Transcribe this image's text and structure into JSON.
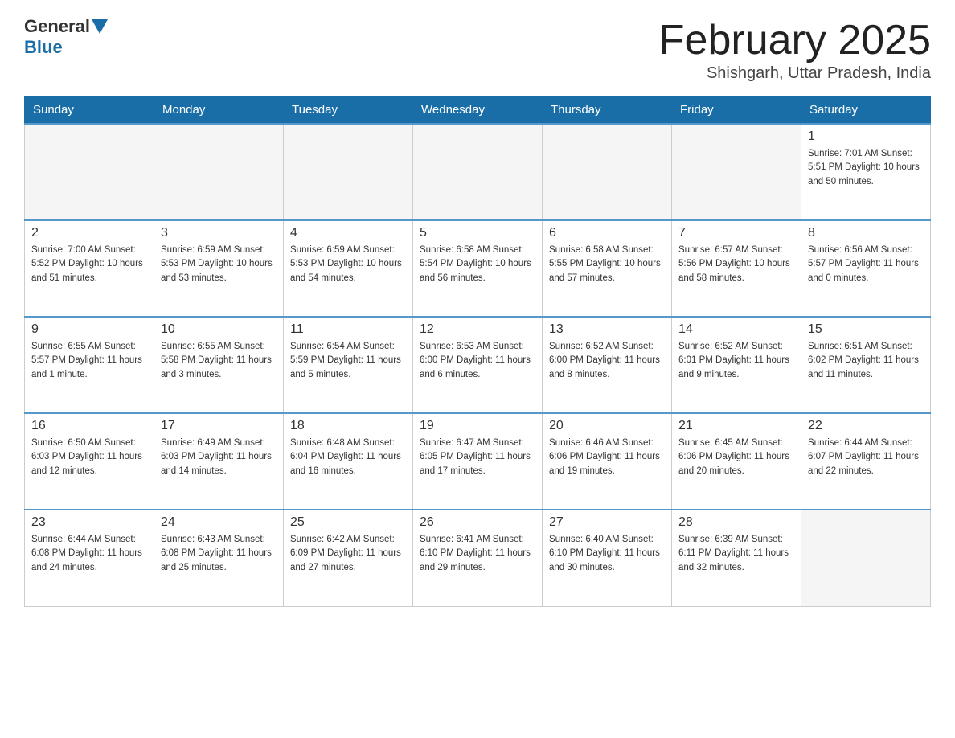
{
  "header": {
    "logo_general": "General",
    "logo_blue": "Blue",
    "month_title": "February 2025",
    "location": "Shishgarh, Uttar Pradesh, India"
  },
  "days_of_week": [
    "Sunday",
    "Monday",
    "Tuesday",
    "Wednesday",
    "Thursday",
    "Friday",
    "Saturday"
  ],
  "weeks": [
    [
      {
        "day": "",
        "info": ""
      },
      {
        "day": "",
        "info": ""
      },
      {
        "day": "",
        "info": ""
      },
      {
        "day": "",
        "info": ""
      },
      {
        "day": "",
        "info": ""
      },
      {
        "day": "",
        "info": ""
      },
      {
        "day": "1",
        "info": "Sunrise: 7:01 AM\nSunset: 5:51 PM\nDaylight: 10 hours and 50 minutes."
      }
    ],
    [
      {
        "day": "2",
        "info": "Sunrise: 7:00 AM\nSunset: 5:52 PM\nDaylight: 10 hours and 51 minutes."
      },
      {
        "day": "3",
        "info": "Sunrise: 6:59 AM\nSunset: 5:53 PM\nDaylight: 10 hours and 53 minutes."
      },
      {
        "day": "4",
        "info": "Sunrise: 6:59 AM\nSunset: 5:53 PM\nDaylight: 10 hours and 54 minutes."
      },
      {
        "day": "5",
        "info": "Sunrise: 6:58 AM\nSunset: 5:54 PM\nDaylight: 10 hours and 56 minutes."
      },
      {
        "day": "6",
        "info": "Sunrise: 6:58 AM\nSunset: 5:55 PM\nDaylight: 10 hours and 57 minutes."
      },
      {
        "day": "7",
        "info": "Sunrise: 6:57 AM\nSunset: 5:56 PM\nDaylight: 10 hours and 58 minutes."
      },
      {
        "day": "8",
        "info": "Sunrise: 6:56 AM\nSunset: 5:57 PM\nDaylight: 11 hours and 0 minutes."
      }
    ],
    [
      {
        "day": "9",
        "info": "Sunrise: 6:55 AM\nSunset: 5:57 PM\nDaylight: 11 hours and 1 minute."
      },
      {
        "day": "10",
        "info": "Sunrise: 6:55 AM\nSunset: 5:58 PM\nDaylight: 11 hours and 3 minutes."
      },
      {
        "day": "11",
        "info": "Sunrise: 6:54 AM\nSunset: 5:59 PM\nDaylight: 11 hours and 5 minutes."
      },
      {
        "day": "12",
        "info": "Sunrise: 6:53 AM\nSunset: 6:00 PM\nDaylight: 11 hours and 6 minutes."
      },
      {
        "day": "13",
        "info": "Sunrise: 6:52 AM\nSunset: 6:00 PM\nDaylight: 11 hours and 8 minutes."
      },
      {
        "day": "14",
        "info": "Sunrise: 6:52 AM\nSunset: 6:01 PM\nDaylight: 11 hours and 9 minutes."
      },
      {
        "day": "15",
        "info": "Sunrise: 6:51 AM\nSunset: 6:02 PM\nDaylight: 11 hours and 11 minutes."
      }
    ],
    [
      {
        "day": "16",
        "info": "Sunrise: 6:50 AM\nSunset: 6:03 PM\nDaylight: 11 hours and 12 minutes."
      },
      {
        "day": "17",
        "info": "Sunrise: 6:49 AM\nSunset: 6:03 PM\nDaylight: 11 hours and 14 minutes."
      },
      {
        "day": "18",
        "info": "Sunrise: 6:48 AM\nSunset: 6:04 PM\nDaylight: 11 hours and 16 minutes."
      },
      {
        "day": "19",
        "info": "Sunrise: 6:47 AM\nSunset: 6:05 PM\nDaylight: 11 hours and 17 minutes."
      },
      {
        "day": "20",
        "info": "Sunrise: 6:46 AM\nSunset: 6:06 PM\nDaylight: 11 hours and 19 minutes."
      },
      {
        "day": "21",
        "info": "Sunrise: 6:45 AM\nSunset: 6:06 PM\nDaylight: 11 hours and 20 minutes."
      },
      {
        "day": "22",
        "info": "Sunrise: 6:44 AM\nSunset: 6:07 PM\nDaylight: 11 hours and 22 minutes."
      }
    ],
    [
      {
        "day": "23",
        "info": "Sunrise: 6:44 AM\nSunset: 6:08 PM\nDaylight: 11 hours and 24 minutes."
      },
      {
        "day": "24",
        "info": "Sunrise: 6:43 AM\nSunset: 6:08 PM\nDaylight: 11 hours and 25 minutes."
      },
      {
        "day": "25",
        "info": "Sunrise: 6:42 AM\nSunset: 6:09 PM\nDaylight: 11 hours and 27 minutes."
      },
      {
        "day": "26",
        "info": "Sunrise: 6:41 AM\nSunset: 6:10 PM\nDaylight: 11 hours and 29 minutes."
      },
      {
        "day": "27",
        "info": "Sunrise: 6:40 AM\nSunset: 6:10 PM\nDaylight: 11 hours and 30 minutes."
      },
      {
        "day": "28",
        "info": "Sunrise: 6:39 AM\nSunset: 6:11 PM\nDaylight: 11 hours and 32 minutes."
      },
      {
        "day": "",
        "info": ""
      }
    ]
  ]
}
